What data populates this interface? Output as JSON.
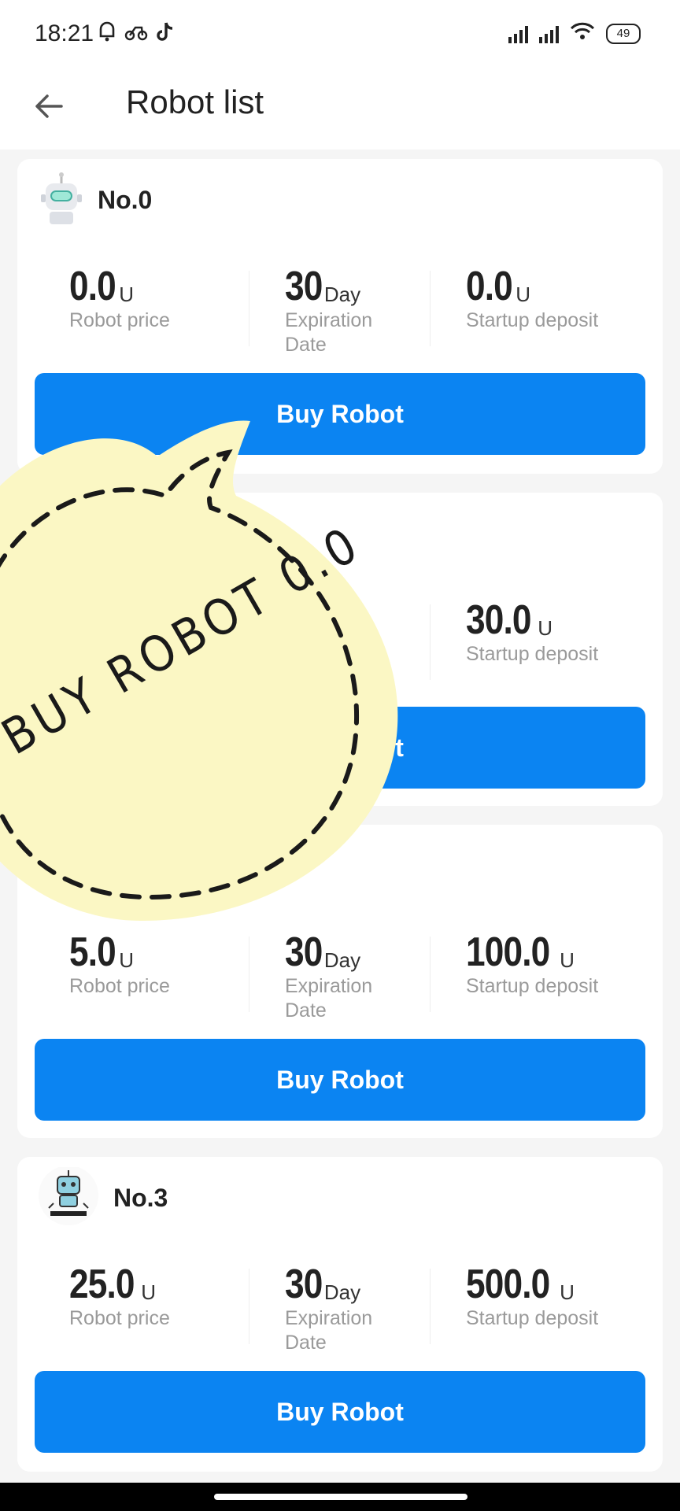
{
  "status_bar": {
    "time": "18:21",
    "battery": "49"
  },
  "header": {
    "title": "Robot list"
  },
  "labels": {
    "robot_price": "Robot price",
    "expiration_line1": "Expiration",
    "expiration_line2": "Date",
    "startup_deposit": "Startup deposit",
    "unit": "U",
    "day": "Day"
  },
  "robots": [
    {
      "name": "No.0",
      "price": "0.0",
      "days": "30",
      "deposit": "0.0",
      "button": "Buy Robot"
    },
    {
      "name": "",
      "price": "",
      "days": "",
      "deposit": "30.0",
      "button": "Buy Robot"
    },
    {
      "name": "",
      "price": "5.0",
      "days": "30",
      "deposit": "100.0",
      "button": "Buy Robot"
    },
    {
      "name": "No.3",
      "price": "25.0",
      "days": "30",
      "deposit": "500.0",
      "button": "Buy Robot"
    }
  ],
  "sticker": {
    "text": "BUY ROBOT 0.0",
    "fill": "#fbf7c4"
  },
  "colors": {
    "accent": "#0b84f2",
    "background": "#f5f5f5"
  }
}
